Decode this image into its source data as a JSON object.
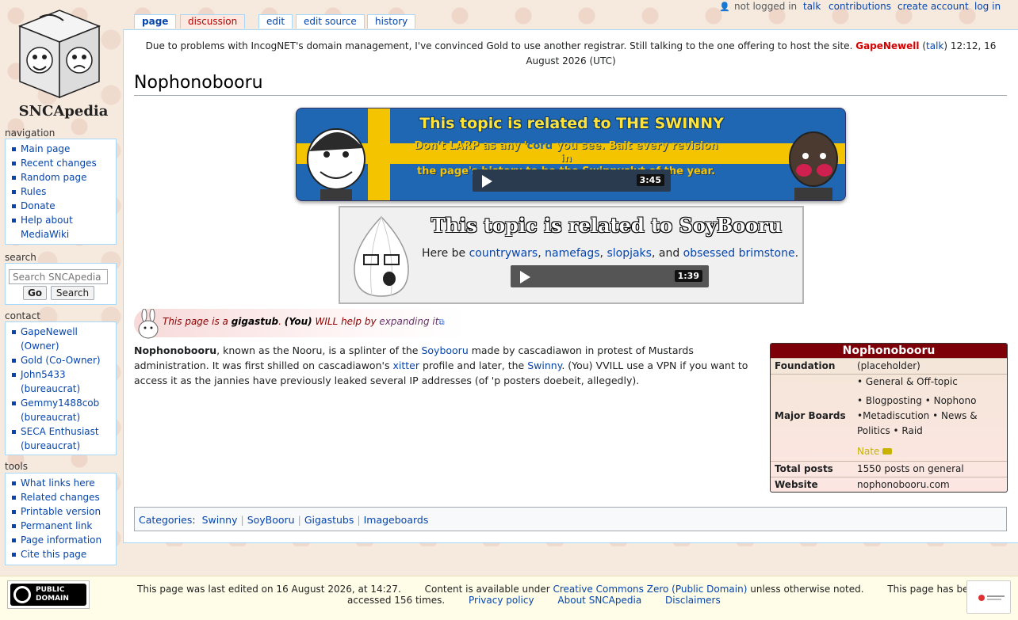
{
  "site": {
    "name": "SNCApedia"
  },
  "personal": {
    "not_logged_in": "not logged in",
    "talk": "talk",
    "contributions": "contributions",
    "create_account": "create account",
    "log_in": "log in"
  },
  "tabs": {
    "page": "page",
    "discussion": "discussion",
    "edit": "edit",
    "edit_source": "edit source",
    "history": "history"
  },
  "navigation": {
    "heading": "navigation",
    "items": [
      "Main page",
      "Recent changes",
      "Random page",
      "Rules",
      "Donate",
      "Help about MediaWiki"
    ]
  },
  "search": {
    "heading": "search",
    "placeholder": "Search SNCApedia",
    "go": "Go",
    "search": "Search"
  },
  "contact": {
    "heading": "contact",
    "items": [
      "GapeNewell (Owner)",
      "Gold (Co-Owner)",
      "John5433 (bureaucrat)",
      "Gemmy1488cob (bureaucrat)",
      "SECA Enthusiast (bureaucrat)"
    ]
  },
  "tools": {
    "heading": "tools",
    "items": [
      "What links here",
      "Related changes",
      "Printable version",
      "Permanent link",
      "Page information",
      "Cite this page"
    ]
  },
  "sitenotice": {
    "text": "Due to problems with IncogNET's domain management, I've convinced Gold to use another registrar. Still talking to the one offering to host the site.",
    "user": "GapeNewell",
    "open_paren": "(",
    "talk": "talk",
    "close_paren": ")",
    "timestamp": "12:12, 16 August 2026 (UTC)"
  },
  "page": {
    "title": "Nophonobooru"
  },
  "swinny_banner": {
    "title": "This topic is related to THE SWINNY",
    "line1_a": "Don't LARP",
    "line1_b": "as any '",
    "line1_c": "cord",
    "line1_d": "you see.",
    "line1_e": "Bait every revision in",
    "line2": "the page's history to be the Swinnyslvt of the year.",
    "duration": "3:45"
  },
  "soy_banner": {
    "title": "This topic is related to SoyBooru",
    "desc_prefix": "Here be",
    "link1": "countrywars",
    "link2": "namefags",
    "link3": "slopjaks",
    "and": ", and",
    "link4": "obsessed brimstone",
    "period": ".",
    "duration": "1:39"
  },
  "stub": {
    "prefix": "This page is a",
    "gigastub": "gigastub",
    "you": "(You)",
    "will": "WILL help by",
    "link": "expanding it"
  },
  "article": {
    "bold_name": "Nophonobooru",
    "t1": ", known as the Nooru, is a splinter of the",
    "soybooru": "Soybooru",
    "t2": "made by cascadiawon in protest of Mustards administration. It was first shilled on cascadiawon's",
    "xitter": "xitter",
    "t3": "profile and later, the",
    "swinny": "Swinny",
    "t4": ". (You) VVILL use a VPN if you want to access it as the jannies have previously leaked several IP addresses (of 'p posters doebeit, allegedly)."
  },
  "infobox": {
    "title": "Nophonobooru",
    "foundation_label": "Foundation",
    "foundation_value": "(placeholder)",
    "boards_label": "Major Boards",
    "boards_line1": "• General & Off-topic",
    "boards_line2": "• Blogposting • Nophono",
    "boards_line3": "•Metadiscution • News &",
    "boards_line4": "Politics • Raid",
    "nate": "Nate",
    "posts_label": "Total posts",
    "posts_value": "1550 posts on general",
    "website_label": "Website",
    "website_value": "nophonobooru.com"
  },
  "categories": {
    "label": "Categories",
    "colon": ":",
    "items": [
      "Swinny",
      "SoyBooru",
      "Gigastubs",
      "Imageboards"
    ]
  },
  "footer": {
    "last_edited": "This page was last edited on 16 August 2026, at 14:27.",
    "content_prefix": "Content is available under",
    "license": "Creative Commons Zero (Public Domain)",
    "content_suffix": "unless otherwise noted.",
    "accessed_1": "This page has been",
    "accessed_2": "accessed 156 times.",
    "privacy": "Privacy policy",
    "about": "About SNCApedia",
    "disclaimers": "Disclaimers",
    "badge_line1": "PUBLIC",
    "badge_line2": "DOMAIN"
  }
}
